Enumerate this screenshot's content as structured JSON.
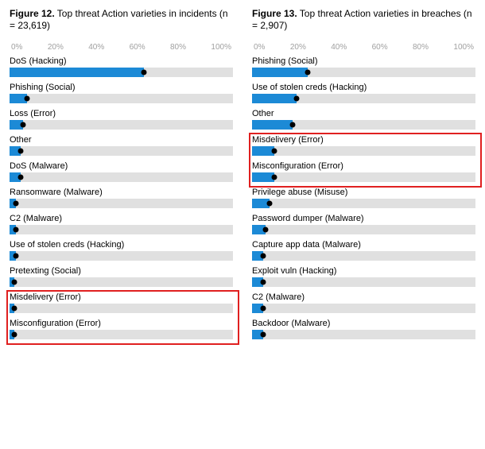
{
  "axis_ticks": [
    "0%",
    "20%",
    "40%",
    "60%",
    "80%",
    "100%"
  ],
  "chart_data": [
    {
      "type": "bar",
      "title_prefix": "Figure 12.",
      "title_rest": " Top threat Action varieties in incidents (n = 23,619)",
      "xlabel": "",
      "ylabel": "",
      "xlim": [
        0,
        100
      ],
      "highlight_indices": [
        9,
        10
      ],
      "series": [
        {
          "label": "DoS (Hacking)",
          "value": 60
        },
        {
          "label": "Phishing (Social)",
          "value": 8
        },
        {
          "label": "Loss (Error)",
          "value": 6
        },
        {
          "label": "Other",
          "value": 5
        },
        {
          "label": "DoS (Malware)",
          "value": 5
        },
        {
          "label": "Ransomware (Malware)",
          "value": 3
        },
        {
          "label": "C2 (Malware)",
          "value": 3
        },
        {
          "label": "Use of stolen creds (Hacking)",
          "value": 3
        },
        {
          "label": "Pretexting (Social)",
          "value": 2
        },
        {
          "label": "Misdelivery (Error)",
          "value": 2
        },
        {
          "label": "Misconfiguration (Error)",
          "value": 2
        }
      ]
    },
    {
      "type": "bar",
      "title_prefix": "Figure 13.",
      "title_rest": " Top threat Action varieties in breaches (n = 2,907)",
      "xlabel": "",
      "ylabel": "",
      "xlim": [
        0,
        100
      ],
      "highlight_indices": [
        3,
        4
      ],
      "series": [
        {
          "label": "Phishing (Social)",
          "value": 25
        },
        {
          "label": "Use of stolen creds (Hacking)",
          "value": 20
        },
        {
          "label": "Other",
          "value": 18
        },
        {
          "label": "Misdelivery (Error)",
          "value": 10
        },
        {
          "label": "Misconfiguration (Error)",
          "value": 10
        },
        {
          "label": "Privilege abuse (Misuse)",
          "value": 8
        },
        {
          "label": "Password dumper (Malware)",
          "value": 6
        },
        {
          "label": "Capture app data (Malware)",
          "value": 5
        },
        {
          "label": "Exploit vuln (Hacking)",
          "value": 5
        },
        {
          "label": "C2 (Malware)",
          "value": 5
        },
        {
          "label": "Backdoor (Malware)",
          "value": 5
        }
      ]
    }
  ]
}
